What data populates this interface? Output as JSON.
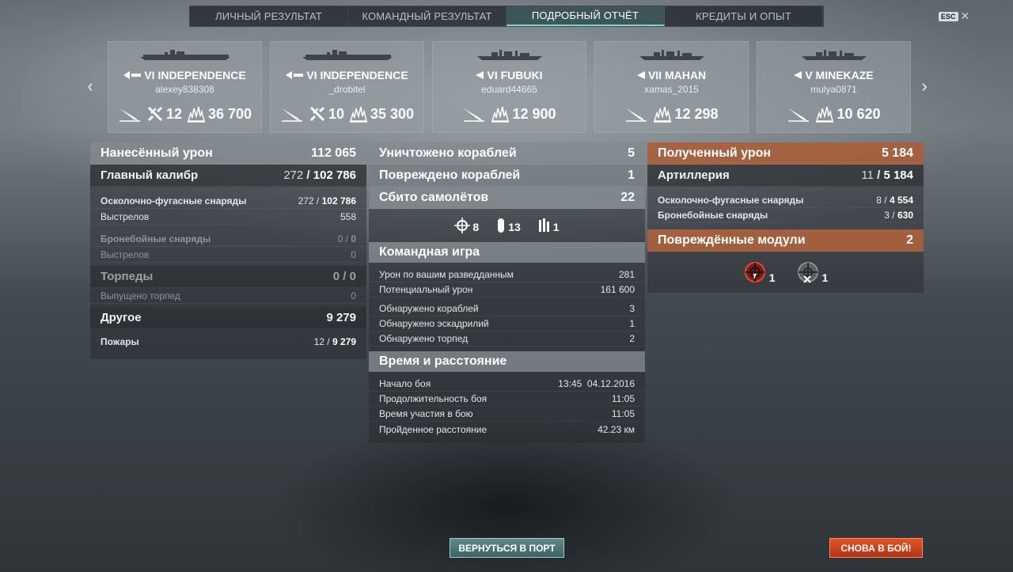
{
  "tabs": [
    {
      "label": "ЛИЧНЫЙ РЕЗУЛЬТАТ"
    },
    {
      "label": "КОМАНДНЫЙ РЕЗУЛЬТАТ"
    },
    {
      "label": "ПОДРОБНЫЙ ОТЧЁТ"
    },
    {
      "label": "КРЕДИТЫ И ОПЫТ"
    }
  ],
  "active_tab": "ПОДРОБНЫЙ ОТЧЁТ",
  "esc": {
    "key": "ESC",
    "close": "✕"
  },
  "carousel": {
    "prev": "‹",
    "next": "›",
    "cards": [
      {
        "tier": "VI",
        "ship": "INDEPENDENCE",
        "player": "alexey838308",
        "planes": "12",
        "damage": "36 700",
        "type": "carrier"
      },
      {
        "tier": "VI",
        "ship": "INDEPENDENCE",
        "player": "_drobitel",
        "planes": "10",
        "damage": "35 300",
        "type": "carrier"
      },
      {
        "tier": "VI",
        "ship": "FUBUKI",
        "player": "eduard44665",
        "damage": "12 900",
        "type": "destroyer"
      },
      {
        "tier": "VII",
        "ship": "MAHAN",
        "player": "xamas_2015",
        "damage": "12 298",
        "type": "destroyer"
      },
      {
        "tier": "V",
        "ship": "MINEKAZE",
        "player": "mulya0871",
        "damage": "10 620",
        "type": "destroyer"
      }
    ]
  },
  "damage_dealt": {
    "title": "Нанесённый урон",
    "total": "112 065",
    "main_battery": {
      "label": "Главный калибр",
      "hits": "272",
      "damage": "102 786"
    },
    "he": {
      "label": "Осколочно-фугасные снаряды",
      "hits": "272",
      "damage": "102 786"
    },
    "he_shots": {
      "label": "Выстрелов",
      "value": "558"
    },
    "ap": {
      "label": "Бронебойные снаряды",
      "hits": "0",
      "damage": "0"
    },
    "ap_shots": {
      "label": "Выстрелов",
      "value": "0"
    },
    "torpedoes": {
      "label": "Торпеды",
      "hits": "0",
      "damage": "0"
    },
    "torpedoes_launched": {
      "label": "Выпущено торпед",
      "value": "0"
    },
    "other": {
      "label": "Другое",
      "value": "9 279"
    },
    "fires": {
      "label": "Пожары",
      "hits": "12",
      "damage": "9 279"
    }
  },
  "center": {
    "destroyed": {
      "label": "Уничтожено кораблей",
      "value": "5"
    },
    "damaged": {
      "label": "Повреждено кораблей",
      "value": "1"
    },
    "planes": {
      "label": "Сбито самолётов",
      "value": "22"
    },
    "plane_icons": {
      "aa": "8",
      "fighters": "13",
      "bombers": "1"
    },
    "team": {
      "title": "Командная игра",
      "spotting_damage": {
        "label": "Урон по вашим разведданным",
        "value": "281"
      },
      "potential_damage": {
        "label": "Потенциальный урон",
        "value": "161 600"
      },
      "spotted_ships": {
        "label": "Обнаружено кораблей",
        "value": "3"
      },
      "spotted_squadrons": {
        "label": "Обнаружено эскадрилий",
        "value": "1"
      },
      "spotted_torpedoes": {
        "label": "Обнаружено торпед",
        "value": "2"
      }
    },
    "time": {
      "title": "Время и расстояние",
      "start": {
        "label": "Начало боя",
        "value": "13:45  04.12.2016"
      },
      "duration": {
        "label": "Продолжительность боя",
        "value": "11:05"
      },
      "participation": {
        "label": "Время участия в бою",
        "value": "11:05"
      },
      "distance": {
        "label": "Пройденное расстояние",
        "value": "42.23 км"
      }
    }
  },
  "damage_received": {
    "title": "Полученный урон",
    "total": "5 184",
    "artillery": {
      "label": "Артиллерия",
      "hits": "11",
      "damage": "5 184"
    },
    "he": {
      "label": "Осколочно-фугасные снаряды",
      "hits": "8",
      "damage": "4 554"
    },
    "ap": {
      "label": "Бронебойные снаряды",
      "hits": "3",
      "damage": "630"
    },
    "modules": {
      "label": "Повреждённые модули",
      "value": "2"
    },
    "module_icons": {
      "steering": "1",
      "engine": "1"
    }
  },
  "buttons": {
    "port": "ВЕРНУТЬСЯ В ПОРТ",
    "battle": "СНОВА В БОЙ!"
  },
  "colors": {
    "accent": "#7ad8d0",
    "received": "#b4643c",
    "battle_button": "#d2441c"
  }
}
